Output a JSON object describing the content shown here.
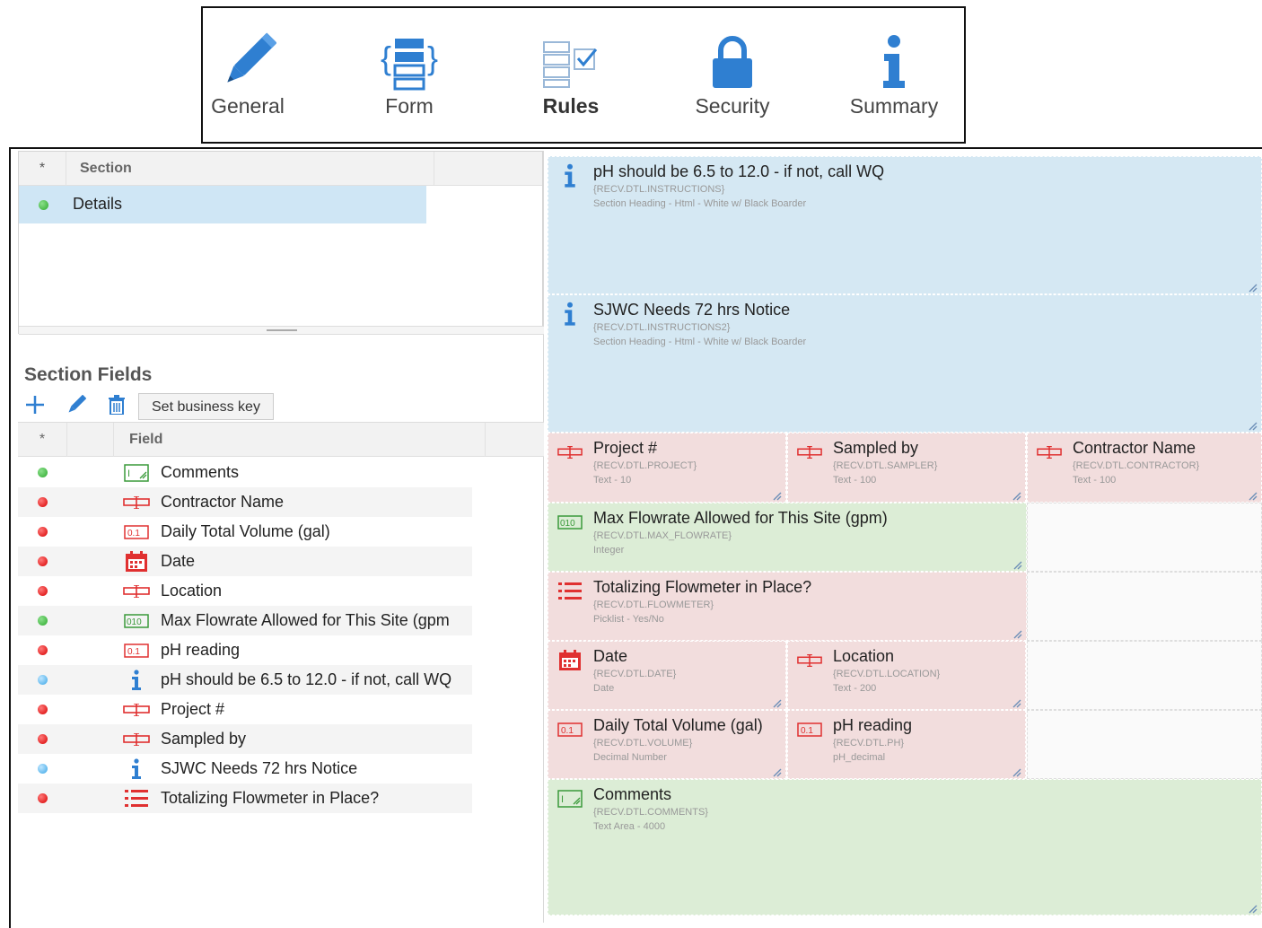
{
  "toolbar": {
    "items": [
      {
        "label": "General",
        "icon": "pencil-icon",
        "active": false
      },
      {
        "label": "Form",
        "icon": "form-icon",
        "active": false
      },
      {
        "label": "Rules",
        "icon": "rules-icon",
        "active": true
      },
      {
        "label": "Security",
        "icon": "lock-icon",
        "active": false
      },
      {
        "label": "Summary",
        "icon": "info-icon",
        "active": false
      }
    ]
  },
  "sections_grid": {
    "star_header": "*",
    "column_header": "Section",
    "rows": [
      {
        "status": "green",
        "label": "Details"
      }
    ]
  },
  "section_fields": {
    "title": "Section Fields",
    "set_business_key": "Set business key",
    "star_header": "*",
    "field_header": "Field",
    "rows": [
      {
        "status": "green",
        "icon": "textarea-icon",
        "label": "Comments"
      },
      {
        "status": "red",
        "icon": "text-field-icon",
        "label": "Contractor Name"
      },
      {
        "status": "red",
        "icon": "decimal-icon",
        "label": "Daily Total Volume (gal)"
      },
      {
        "status": "red",
        "icon": "calendar-icon",
        "label": "Date"
      },
      {
        "status": "red",
        "icon": "text-field-icon",
        "label": "Location"
      },
      {
        "status": "green",
        "icon": "integer-icon",
        "label": "Max Flowrate Allowed for This Site (gpm"
      },
      {
        "status": "red",
        "icon": "decimal-icon",
        "label": "pH reading"
      },
      {
        "status": "blue",
        "icon": "info-icon",
        "label": "pH should be 6.5 to 12.0 - if not, call WQ"
      },
      {
        "status": "red",
        "icon": "text-field-icon",
        "label": "Project #"
      },
      {
        "status": "red",
        "icon": "text-field-icon",
        "label": "Sampled by"
      },
      {
        "status": "blue",
        "icon": "info-icon",
        "label": "SJWC Needs 72 hrs Notice"
      },
      {
        "status": "red",
        "icon": "picklist-icon",
        "label": "Totalizing Flowmeter in Place?"
      }
    ]
  },
  "layout_cards": [
    {
      "color": "blue",
      "icon": "info-icon",
      "title": "pH should be 6.5 to 12.0 - if not, call WQ",
      "code": "{RECV.DTL.INSTRUCTIONS}",
      "type": "Section Heading - Html - White w/ Black Boarder"
    },
    {
      "color": "blue",
      "icon": "info-icon",
      "title": "SJWC Needs 72 hrs Notice",
      "code": "{RECV.DTL.INSTRUCTIONS2}",
      "type": "Section Heading - Html - White w/ Black Boarder"
    },
    {
      "color": "red",
      "icon": "text-field-icon",
      "title": "Project #",
      "code": "{RECV.DTL.PROJECT}",
      "type": "Text - 10"
    },
    {
      "color": "red",
      "icon": "text-field-icon",
      "title": "Sampled by",
      "code": "{RECV.DTL.SAMPLER}",
      "type": "Text - 100"
    },
    {
      "color": "red",
      "icon": "text-field-icon",
      "title": "Contractor Name",
      "code": "{RECV.DTL.CONTRACTOR}",
      "type": "Text - 100"
    },
    {
      "color": "green",
      "icon": "integer-icon",
      "title": "Max Flowrate Allowed for This Site (gpm)",
      "code": "{RECV.DTL.MAX_FLOWRATE}",
      "type": "Integer"
    },
    {
      "color": "red",
      "icon": "picklist-icon",
      "title": "Totalizing Flowmeter in Place?",
      "code": "{RECV.DTL.FLOWMETER}",
      "type": "Picklist - Yes/No"
    },
    {
      "color": "red",
      "icon": "calendar-icon",
      "title": "Date",
      "code": "{RECV.DTL.DATE}",
      "type": "Date"
    },
    {
      "color": "red",
      "icon": "text-field-icon",
      "title": "Location",
      "code": "{RECV.DTL.LOCATION}",
      "type": "Text - 200"
    },
    {
      "color": "red",
      "icon": "decimal-icon",
      "title": "Daily Total Volume (gal)",
      "code": "{RECV.DTL.VOLUME}",
      "type": "Decimal Number"
    },
    {
      "color": "red",
      "icon": "decimal-icon",
      "title": "pH reading",
      "code": "{RECV.DTL.PH}",
      "type": "pH_decimal"
    },
    {
      "color": "green",
      "icon": "textarea-icon",
      "title": "Comments",
      "code": "{RECV.DTL.COMMENTS}",
      "type": "Text Area - 4000"
    }
  ],
  "colors": {
    "accent": "#2f7fd1",
    "status_green": "#2faa2f",
    "status_red": "#d80000",
    "status_blue": "#3aa6e6",
    "card_blue": "#d5e8f3",
    "card_red": "#f2dddd",
    "card_green": "#dcedd6",
    "selected_row": "#cfe6f5"
  }
}
